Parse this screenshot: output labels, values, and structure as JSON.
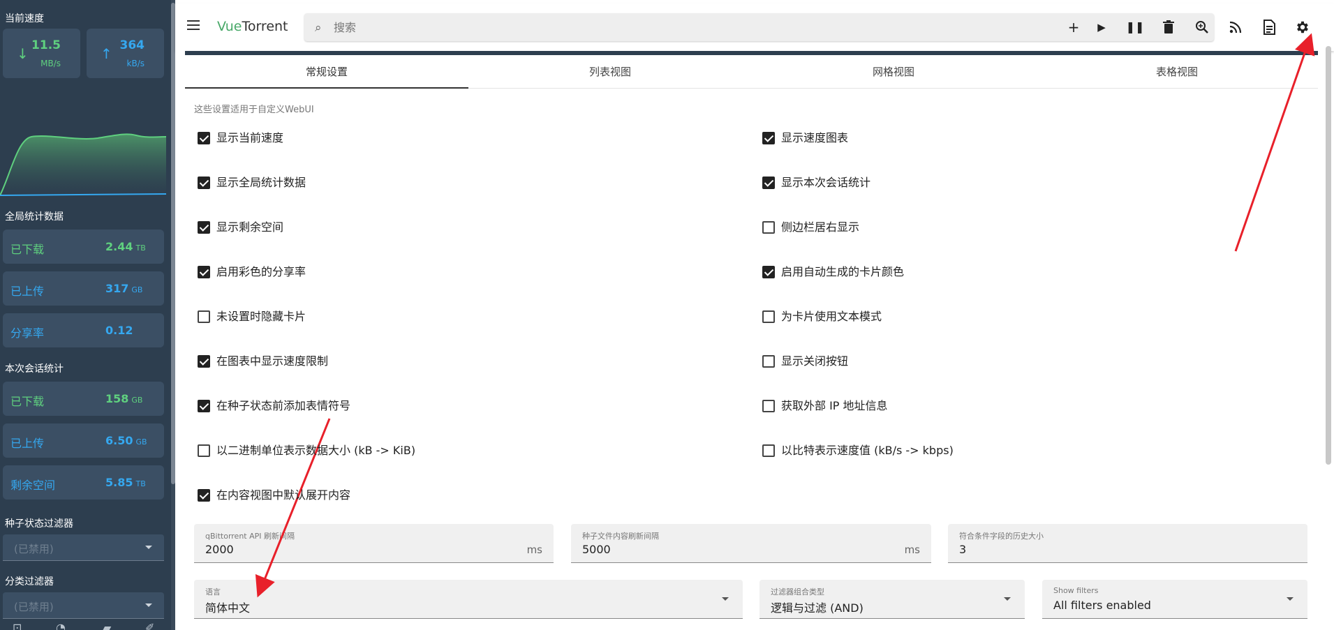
{
  "sidebar": {
    "current_speed_title": "当前速度",
    "download": {
      "value": "11.5",
      "unit": "MB/s"
    },
    "upload": {
      "value": "364",
      "unit": "kB/s"
    },
    "global_title": "全局统计数据",
    "global": [
      {
        "label": "已下载",
        "value": "2.44",
        "unit": "TB",
        "color": "green"
      },
      {
        "label": "已上传",
        "value": "317",
        "unit": "GB",
        "color": "blue"
      },
      {
        "label": "分享率",
        "value": "0.12",
        "unit": "",
        "color": "blue"
      }
    ],
    "session_title": "本次会话统计",
    "session": [
      {
        "label": "已下载",
        "value": "158",
        "unit": "GB",
        "color": "green"
      },
      {
        "label": "已上传",
        "value": "6.50",
        "unit": "GB",
        "color": "blue"
      },
      {
        "label": "剩余空间",
        "value": "5.85",
        "unit": "TB",
        "color": "blue"
      }
    ],
    "state_filter_title": "种子状态过滤器",
    "state_filter_value": "(已禁用)",
    "category_filter_title": "分类过滤器",
    "category_filter_value": "(已禁用)"
  },
  "topbar": {
    "title_accent": "Vue",
    "title_rest": "Torrent",
    "search_placeholder": "搜索",
    "buttons": [
      "add-icon",
      "play-icon",
      "pause-icon",
      "delete-icon",
      "search-plugin-icon",
      "rss-icon",
      "log-icon",
      "settings-icon"
    ]
  },
  "tabs": [
    "常规设置",
    "列表视图",
    "网格视图",
    "表格视图"
  ],
  "hint": "这些设置适用于自定义WebUI",
  "options_left": [
    {
      "label": "显示当前速度",
      "checked": true
    },
    {
      "label": "显示全局统计数据",
      "checked": true
    },
    {
      "label": "显示剩余空间",
      "checked": true
    },
    {
      "label": "启用彩色的分享率",
      "checked": true
    },
    {
      "label": "未设置时隐藏卡片",
      "checked": false
    },
    {
      "label": "在图表中显示速度限制",
      "checked": true
    },
    {
      "label": "在种子状态前添加表情符号",
      "checked": true
    },
    {
      "label": "以二进制单位表示数据大小 (kB -> KiB)",
      "checked": false
    },
    {
      "label": "在内容视图中默认展开内容",
      "checked": true
    }
  ],
  "options_right": [
    {
      "label": "显示速度图表",
      "checked": true
    },
    {
      "label": "显示本次会话统计",
      "checked": true
    },
    {
      "label": "侧边栏居右显示",
      "checked": false
    },
    {
      "label": "启用自动生成的卡片颜色",
      "checked": true
    },
    {
      "label": "为卡片使用文本模式",
      "checked": false
    },
    {
      "label": "显示关闭按钮",
      "checked": false
    },
    {
      "label": "获取外部 IP 地址信息",
      "checked": false
    },
    {
      "label": "以比特表示速度值 (kB/s -> kbps)",
      "checked": false
    }
  ],
  "fields": {
    "api_interval": {
      "label": "qBittorrent API 刷新间隔",
      "value": "2000",
      "suffix": "ms"
    },
    "content_interval": {
      "label": "种子文件内容刷新间隔",
      "value": "5000",
      "suffix": "ms"
    },
    "history_size": {
      "label": "符合条件字段的历史大小",
      "value": "3"
    },
    "language": {
      "label": "语言",
      "value": "简体中文"
    },
    "filter_type": {
      "label": "过滤器组合类型",
      "value": "逻辑与过滤 (AND)"
    },
    "show_filters": {
      "label": "Show filters",
      "value": "All filters enabled"
    }
  },
  "colors": {
    "sidebar_bg": "#2d3e4f",
    "card_bg": "#3b4f64",
    "green": "#5fd07f",
    "blue": "#35a8f0",
    "accent": "#48a868",
    "arrow": "#e8202a"
  }
}
